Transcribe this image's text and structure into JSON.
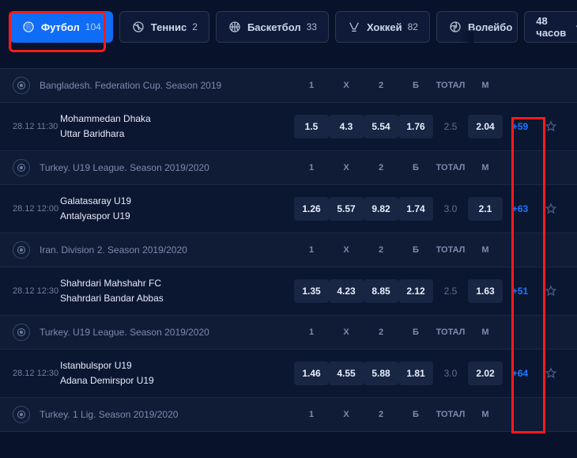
{
  "tabs": [
    {
      "label": "Футбол",
      "count": "104",
      "active": true,
      "icon": "football"
    },
    {
      "label": "Теннис",
      "count": "2",
      "active": false,
      "icon": "tennis"
    },
    {
      "label": "Баскетбол",
      "count": "33",
      "active": false,
      "icon": "basketball"
    },
    {
      "label": "Хоккей",
      "count": "82",
      "active": false,
      "icon": "hockey"
    },
    {
      "label": "Волейбо",
      "count": "",
      "active": false,
      "icon": "volleyball"
    }
  ],
  "timeFilter": {
    "label": "48 часов"
  },
  "columns": {
    "c1": "1",
    "cx": "Х",
    "c2": "2",
    "cb": "Б",
    "ct": "ТОТАЛ",
    "cm": "М"
  },
  "leagues": [
    {
      "name": "Bangladesh. Federation Cup. Season 2019",
      "matches": [
        {
          "date": "28.12",
          "time": "11:30",
          "team1": "Mohammedan Dhaka",
          "team2": "Uttar Baridhara",
          "o1": "1.5",
          "ox": "4.3",
          "o2": "5.54",
          "ob": "1.76",
          "ot": "2.5",
          "om": "2.04",
          "more": "+59"
        }
      ]
    },
    {
      "name": "Turkey. U19 League. Season 2019/2020",
      "matches": [
        {
          "date": "28.12",
          "time": "12:00",
          "team1": "Galatasaray U19",
          "team2": "Antalyaspor U19",
          "o1": "1.26",
          "ox": "5.57",
          "o2": "9.82",
          "ob": "1.74",
          "ot": "3.0",
          "om": "2.1",
          "more": "+63"
        }
      ]
    },
    {
      "name": "Iran. Division 2. Season 2019/2020",
      "matches": [
        {
          "date": "28.12",
          "time": "12:30",
          "team1": "Shahrdari Mahshahr FC",
          "team2": "Shahrdari Bandar Abbas",
          "o1": "1.35",
          "ox": "4.23",
          "o2": "8.85",
          "ob": "2.12",
          "ot": "2.5",
          "om": "1.63",
          "more": "+51"
        }
      ]
    },
    {
      "name": "Turkey. U19 League. Season 2019/2020",
      "matches": [
        {
          "date": "28.12",
          "time": "12:30",
          "team1": "Istanbulspor U19",
          "team2": "Adana Demirspor U19",
          "o1": "1.46",
          "ox": "4.55",
          "o2": "5.88",
          "ob": "1.81",
          "ot": "3.0",
          "om": "2.02",
          "more": "+64"
        }
      ]
    },
    {
      "name": "Turkey. 1 Lig. Season 2019/2020",
      "matches": []
    }
  ]
}
